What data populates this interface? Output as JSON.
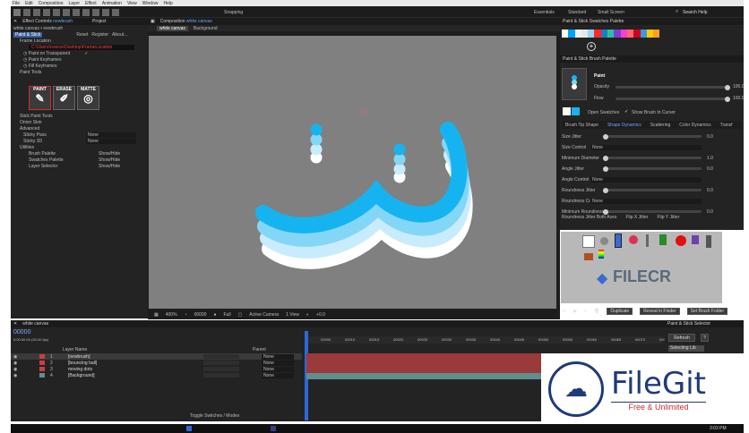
{
  "menu": [
    "File",
    "Edit",
    "Composition",
    "Layer",
    "Effect",
    "Animation",
    "View",
    "Window",
    "Help"
  ],
  "toolbar": {
    "snapping": "Snapping",
    "workspaces": [
      "Essentials",
      "Standard",
      "Small Screen"
    ],
    "search": "Search Help"
  },
  "effect_controls": {
    "tab": "Effect Controls",
    "tab_layer": "newbrush",
    "project_tab": "Project",
    "layer_path": "white canvas • newbrush",
    "effect_name": "Paint & Stick",
    "reset": "Reset",
    "register": "Register",
    "about": "About...",
    "frame_location": "Frame Location",
    "path": "C:\\Users\\rvance\\Desktop\\FrameLocation",
    "paint_transparent": "Paint on Transparent",
    "check": "✓",
    "paint_keyframes": "Paint Keyframes",
    "fill_keyframes": "Fill Keyframes",
    "paint_tools": "Paint Tools",
    "tools": [
      "PAINT",
      "ERASE",
      "MATTE"
    ],
    "stick_tools": "Stick Paint Tools",
    "onion": "Onion Skin",
    "advanced": "Advanced",
    "sticky_pass": "Sticky Pass",
    "sticky_pass_val": "None",
    "sticky_3d": "Sticky 3D",
    "sticky_3d_val": "None",
    "utilities": "Utilities",
    "util_rows": [
      {
        "label": "Brush Palette",
        "btn": "Show/Hide"
      },
      {
        "label": "Swatches Palette",
        "btn": "Show/Hide"
      },
      {
        "label": "Layer Selector",
        "btn": "Show/Hide"
      }
    ]
  },
  "composition": {
    "tab": "Composition",
    "tab_name": "white canvas",
    "crumbs": [
      "white canvas",
      "Background"
    ],
    "zoom": "400%",
    "timecode": "00000",
    "resolution": "Full",
    "camera": "Active Camera",
    "view": "1 View",
    "offset": "+0.0"
  },
  "swatches": {
    "title": "Paint & Stick Swatches Palette",
    "colors": [
      "#ffffff",
      "#00a0ff",
      "#f0f0f0",
      "#e8e8e8",
      "#9cd4f2",
      "#ff2a2a",
      "#1f7cc0",
      "#2cc0a0",
      "#7a3fd0",
      "#ff3dd0",
      "#ff6a6a",
      "#d00022",
      "#3a9adf",
      "#ffcc00",
      "#ffa020"
    ],
    "add": "+"
  },
  "brush_palette": {
    "title": "Paint & Stick Brush Palette",
    "mode": "Paint",
    "opacity_label": "Opacity",
    "opacity": "100.0",
    "flow_label": "Flow",
    "flow": "100.0",
    "open_swatches": "Open Swatches",
    "show_brush": "Show Brush In Cursor",
    "tabs": [
      "Brush Tip Shape",
      "Shape Dynamics",
      "Scattering",
      "Color Dynamics",
      "Transf"
    ],
    "params": [
      {
        "label": "Size Jitter",
        "value": "0.0",
        "kind": "slider",
        "level": 0
      },
      {
        "label": "Size Control",
        "value": "None",
        "kind": "select"
      },
      {
        "label": "Minimum Diameter",
        "value": "1.0",
        "kind": "slider",
        "level": 0
      },
      {
        "label": "Angle Jitter",
        "value": "0.0",
        "kind": "slider",
        "level": 0
      },
      {
        "label": "Angle Control",
        "value": "None",
        "kind": "select"
      },
      {
        "label": "Roundness Jitter",
        "value": "0.0",
        "kind": "slider",
        "level": 0
      },
      {
        "label": "Roundness Control",
        "value": "None",
        "kind": "select"
      },
      {
        "label": "Minimum Roundness",
        "value": "0.0",
        "kind": "slider",
        "level": 0
      }
    ],
    "flip_both": "Roundness Jitter Both Axes",
    "flip_x": "Flip X Jitter",
    "flip_y": "Flip Y Jitter",
    "duplicate": "Duplicate",
    "reveal": "Reveal in Finder",
    "set_folder": "Set Brush Folder"
  },
  "watermark_filecr": {
    "text": "FILECR",
    ".com": ".com"
  },
  "timeline": {
    "tab": "white canvas",
    "timecode": "0:00:00:00 (30.00 fps)",
    "source_header": "Layer Name",
    "parent_header": "Parent",
    "layers": [
      {
        "num": "1",
        "name": "[newbrush]",
        "parent": "None",
        "color": "#c84040"
      },
      {
        "num": "2",
        "name": "[bouncing ball]",
        "parent": "None",
        "color": "#c84040"
      },
      {
        "num": "3",
        "name": "moving dots",
        "parent": "None",
        "color": "#c84040"
      },
      {
        "num": "4",
        "name": "[Background]",
        "parent": "None",
        "color": "#5e8f8f"
      }
    ],
    "ruler": [
      "00005",
      "00010",
      "00015",
      "00020",
      "00025",
      "00030",
      "00035",
      "00040",
      "00045",
      "00050",
      "00055",
      "00060",
      "00065",
      "00070",
      "00075"
    ],
    "toggle": "Toggle Switches / Modes"
  },
  "selector": {
    "title": "Paint & Stick Selector",
    "refresh": "Refresh",
    "help": "?",
    "item": "Selecting Lib"
  },
  "filegit": {
    "name": "FileGit",
    "tagline": "Free & Unlimited"
  },
  "taskbar": {
    "time": "3:03 PM"
  }
}
